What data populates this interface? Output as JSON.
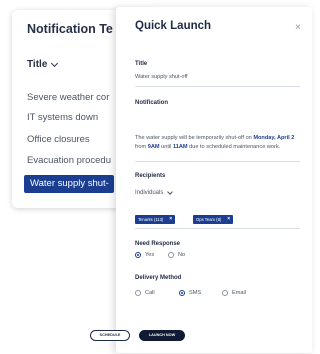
{
  "background_panel": {
    "title": "Notification Te",
    "sort_label": "Title",
    "templates": [
      "Severe weather cor",
      "IT systems down",
      "Office closures",
      "Evacuation procedu",
      "Water supply shut-"
    ],
    "selected_index": 4
  },
  "modal": {
    "title": "Quick Launch",
    "close_glyph": "×",
    "title_label": "Title",
    "title_value": "Water supply shut-off",
    "notification_label": "Notification",
    "notification_text": {
      "part1": "The water supply will be temporarily shut-off on ",
      "date": "Monday, April 2",
      "part2": " from ",
      "start": "9AM",
      "part3": " until ",
      "end": "11AM",
      "part4": " due to scheduled maintenance work."
    },
    "recipients_label": "Recipients",
    "recipients_dropdown": "Individuals",
    "recipient_chips": [
      "Tenants (113)",
      "Ops Team (8)"
    ],
    "chip_remove_glyph": "×",
    "need_response_label": "Need Response",
    "need_response_options": [
      "Yes",
      "No"
    ],
    "need_response_selected": "Yes",
    "delivery_label": "Delivery Method",
    "delivery_options": [
      "Call",
      "SMS",
      "Email"
    ],
    "delivery_selected": "SMS",
    "schedule_button": "SCHEDULE",
    "launch_button": "LAUNCH NOW"
  },
  "colors": {
    "accent": "#1b3e91",
    "primary_button": "#111a33",
    "text": "#1f2a44",
    "muted_text": "#4b5565"
  }
}
